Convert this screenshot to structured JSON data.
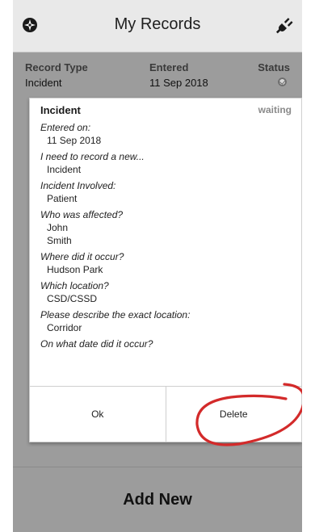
{
  "header": {
    "title": "My Records",
    "left_icon": "compass-icon",
    "right_icon": "plug-icon"
  },
  "records_table": {
    "columns": [
      "Record Type",
      "Entered",
      "Status"
    ],
    "row": {
      "type": "Incident",
      "entered": "11 Sep 2018",
      "status_icon": "check-circle-icon"
    }
  },
  "detail_card": {
    "title": "Incident",
    "status": "waiting",
    "fields": [
      {
        "question": "Entered on:",
        "answer": [
          "11 Sep 2018"
        ]
      },
      {
        "question": "I need to record a new...",
        "answer": [
          "Incident"
        ]
      },
      {
        "question": "Incident Involved:",
        "answer": [
          "Patient"
        ]
      },
      {
        "question": "Who was affected?",
        "answer": [
          "John",
          "Smith"
        ]
      },
      {
        "question": "Where did it occur?",
        "answer": [
          "Hudson Park"
        ]
      },
      {
        "question": "Which location?",
        "answer": [
          "CSD/CSSD"
        ]
      },
      {
        "question": "Please describe the exact location:",
        "answer": [
          "Corridor"
        ]
      },
      {
        "question": "On what date did it occur?",
        "answer": []
      }
    ],
    "ok_label": "Ok",
    "delete_label": "Delete"
  },
  "bottom": {
    "add_new_label": "Add New"
  },
  "colors": {
    "header_bg": "#e9e9e9",
    "app_bg": "#9c9c9c",
    "card_bg": "#ffffff",
    "annotation_red": "#d32a2a"
  }
}
